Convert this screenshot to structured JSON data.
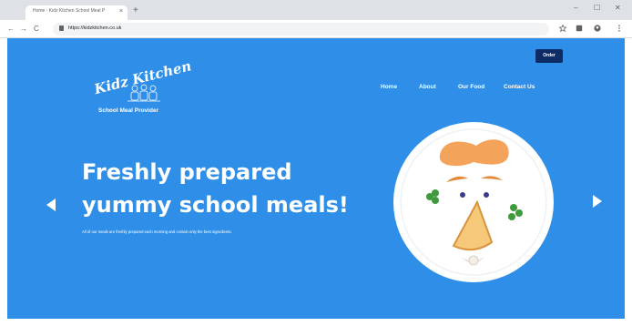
{
  "browser": {
    "tab_title": "Home - Kidz Kitchen School Meal P",
    "tab_close": "×",
    "new_tab": "+",
    "window_controls": [
      "–",
      "☐",
      "✕"
    ],
    "nav": {
      "back": "←",
      "forward": "→",
      "reload": "C"
    },
    "url": "https://kidzkitchen.co.uk"
  },
  "icons": {
    "lock": "lock-icon",
    "star": "star-icon",
    "extensions": "extensions-icon",
    "profile": "profile-icon",
    "menu": "menu-icon"
  },
  "site": {
    "logo": {
      "name": "Kidz Kitchen",
      "subtitle": "School Meal Provider"
    },
    "order_button": "Order",
    "nav": [
      "Home",
      "About",
      "Our Food",
      "Contact Us"
    ],
    "hero": {
      "title_line1": "Freshly prepared",
      "title_line2": "yummy school meals!",
      "text": "All of our meals are freshly prepared each morning and contain only the best ingredients."
    }
  },
  "colors": {
    "hero_bg": "#2f8fe8",
    "order_button_bg": "#0d2c66",
    "text": "#ffffff"
  }
}
